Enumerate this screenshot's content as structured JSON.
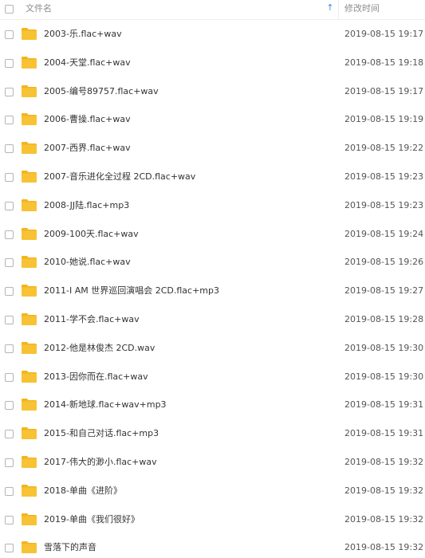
{
  "header": {
    "name_label": "文件名",
    "sort_icon": "sort-ascending-arrow-icon",
    "date_label": "修改时间"
  },
  "files": [
    {
      "name": "2003-乐.flac+wav",
      "modified": "2019-08-15 19:17"
    },
    {
      "name": "2004-天堂.flac+wav",
      "modified": "2019-08-15 19:18"
    },
    {
      "name": "2005-编号89757.flac+wav",
      "modified": "2019-08-15 19:17"
    },
    {
      "name": "2006-曹操.flac+wav",
      "modified": "2019-08-15 19:19"
    },
    {
      "name": "2007-西界.flac+wav",
      "modified": "2019-08-15 19:22"
    },
    {
      "name": "2007-音乐进化全过程 2CD.flac+wav",
      "modified": "2019-08-15 19:23"
    },
    {
      "name": "2008-JJ陆.flac+mp3",
      "modified": "2019-08-15 19:23"
    },
    {
      "name": "2009-100天.flac+wav",
      "modified": "2019-08-15 19:24"
    },
    {
      "name": "2010-她说.flac+wav",
      "modified": "2019-08-15 19:26"
    },
    {
      "name": "2011-I AM 世界巡回演唱会 2CD.flac+mp3",
      "modified": "2019-08-15 19:27"
    },
    {
      "name": "2011-学不会.flac+wav",
      "modified": "2019-08-15 19:28"
    },
    {
      "name": "2012-他是林俊杰 2CD.wav",
      "modified": "2019-08-15 19:30"
    },
    {
      "name": "2013-因你而在.flac+wav",
      "modified": "2019-08-15 19:30"
    },
    {
      "name": "2014-新地球.flac+wav+mp3",
      "modified": "2019-08-15 19:31"
    },
    {
      "name": "2015-和自己对话.flac+mp3",
      "modified": "2019-08-15 19:31"
    },
    {
      "name": "2017-伟大的渺小.flac+wav",
      "modified": "2019-08-15 19:32"
    },
    {
      "name": "2018-单曲《进阶》",
      "modified": "2019-08-15 19:32"
    },
    {
      "name": "2019-单曲《我们很好》",
      "modified": "2019-08-15 19:32"
    },
    {
      "name": "雪落下的声音",
      "modified": "2019-08-15 19:32"
    }
  ],
  "colors": {
    "folder": "#f7c334",
    "folder_tab": "#f3b41e",
    "sort_arrow": "#3a8ee6"
  }
}
